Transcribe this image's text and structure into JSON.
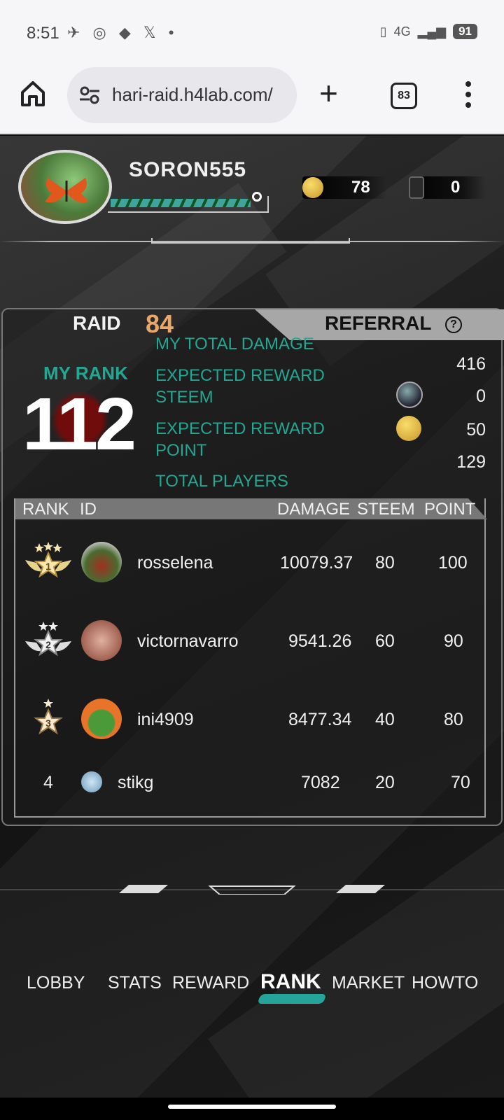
{
  "status": {
    "time": "8:51",
    "network": "4G",
    "battery": "91"
  },
  "browser": {
    "url": "hari-raid.h4lab.com/",
    "tabs_count": "83"
  },
  "header": {
    "username": "SORON555",
    "exp_progress": 0.95,
    "coins": "78",
    "tickets": "0"
  },
  "panel": {
    "raid_label": "RAID",
    "raid_number": "84",
    "referral_label": "REFERRAL",
    "help_glyph": "?",
    "my_rank_label": "MY RANK",
    "my_rank_value": "112",
    "stats": {
      "total_damage_label": "MY TOTAL DAMAGE",
      "total_damage_value": "416",
      "reward_steem_label": "EXPECTED REWARD STEEM",
      "reward_steem_value": "0",
      "reward_point_label": "EXPECTED REWARD POINT",
      "reward_point_value": "50",
      "total_players_label": "TOTAL PLAYERS",
      "total_players_value": "129"
    }
  },
  "table": {
    "headers": [
      "RANK",
      "ID",
      "DAMAGE",
      "STEEM",
      "POINT"
    ],
    "rows": [
      {
        "rank": "1",
        "id": "rosselena",
        "damage": "10079.37",
        "steem": "80",
        "point": "100"
      },
      {
        "rank": "2",
        "id": "victornavarro",
        "damage": "9541.26",
        "steem": "60",
        "point": "90"
      },
      {
        "rank": "3",
        "id": "ini4909",
        "damage": "8477.34",
        "steem": "40",
        "point": "80"
      },
      {
        "rank": "4",
        "id": "stikg",
        "damage": "7082",
        "steem": "20",
        "point": "70"
      }
    ]
  },
  "nav": {
    "items": [
      "LOBBY",
      "STATS",
      "REWARD",
      "RANK",
      "MARKET",
      "HOWTO"
    ],
    "active": "RANK"
  },
  "colors": {
    "accent": "#22a792",
    "raid_number": "#e8a86b"
  }
}
